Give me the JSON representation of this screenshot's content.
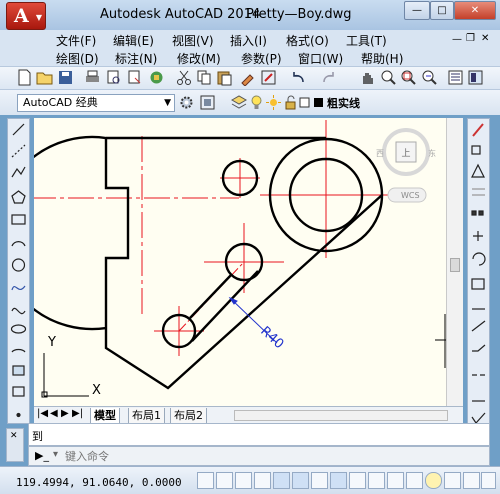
{
  "window": {
    "app_title": "Autodesk AutoCAD 2014",
    "file_name": "Pretty—Boy.dwg",
    "app_button_letter": "A",
    "controls": {
      "minimize": "—",
      "restore": "□",
      "close": "✕"
    }
  },
  "menubar": {
    "row1": [
      "文件(F)",
      "编辑(E)",
      "视图(V)",
      "插入(I)",
      "格式(O)",
      "工具(T)"
    ],
    "row2": [
      "绘图(D)",
      "标注(N)",
      "修改(M)",
      "参数(P)",
      "窗口(W)",
      "帮助(H)"
    ]
  },
  "workspace": {
    "selected": "AutoCAD 经典",
    "lineweight_label": "粗实线"
  },
  "drawing": {
    "dimension_text": "R40",
    "wcs_label": "WCS",
    "viewcube_label": "上",
    "ucs_y": "Y",
    "ucs_x": "X"
  },
  "layout_tabs": [
    "模型",
    "布局1",
    "布局2"
  ],
  "command": {
    "history_text": "到",
    "prompt_placeholder": "键入命令"
  },
  "status": {
    "coordinates": "119.4994, 91.0640, 0.0000"
  },
  "colors": {
    "canvas": "#fffef2",
    "crosshair": "#e8141e",
    "dimension": "#2233cc",
    "outline": "#000000"
  }
}
